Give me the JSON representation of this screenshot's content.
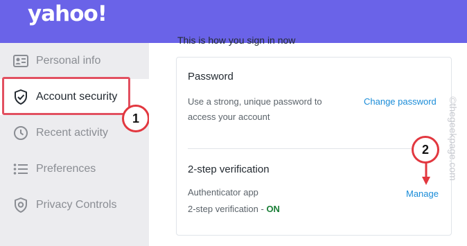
{
  "header": {
    "logo_text": "yahoo!"
  },
  "sidebar": {
    "items": [
      {
        "label": "Personal info",
        "icon": "id-card-icon"
      },
      {
        "label": "Account security",
        "icon": "shield-icon",
        "active": true
      },
      {
        "label": "Recent activity",
        "icon": "clock-icon"
      },
      {
        "label": "Preferences",
        "icon": "list-icon"
      },
      {
        "label": "Privacy Controls",
        "icon": "privacy-shield-icon"
      }
    ]
  },
  "main": {
    "section_intro": "This is how you sign in now",
    "password": {
      "title": "Password",
      "description_line1": "Use a strong, unique password to",
      "description_line2": "access your account",
      "link": "Change password"
    },
    "two_step": {
      "title": "2-step verification",
      "method": "Authenticator app",
      "status_prefix": "2-step verification - ",
      "status": "ON",
      "link": "Manage"
    }
  },
  "annotations": {
    "callout_1": "1",
    "callout_2": "2"
  },
  "watermark": "©thegeekpage.com",
  "colors": {
    "header": "#6a63e8",
    "link": "#1a8cd8",
    "status_on": "#1a7f37",
    "annotation_red": "#e2373f"
  }
}
